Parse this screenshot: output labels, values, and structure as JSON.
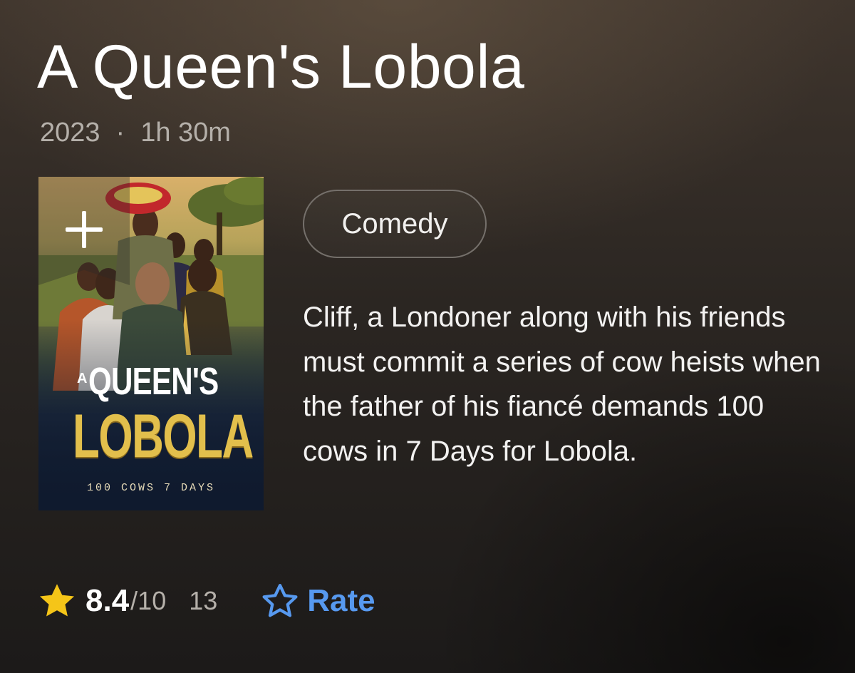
{
  "title": "A Queen's Lobola",
  "meta": {
    "year": "2023",
    "separator": "·",
    "runtime": "1h 30m"
  },
  "poster": {
    "title_small": "A",
    "title_line1": "QUEEN'S",
    "title_line2": "LOBOLA",
    "tagline": "100 COWS 7 DAYS",
    "watchlist_icon": "plus-icon"
  },
  "genres": [
    "Comedy"
  ],
  "plot": "Cliff, a Londoner along with his friends must commit a series of cow heists when the father of his fiancé demands 100 cows in 7 Days for Lobola.",
  "rating": {
    "score": "8.4",
    "max": "/10",
    "votes": "13",
    "rate_label": "Rate",
    "star_icon": "star-icon",
    "rate_icon": "star-outline-icon",
    "colors": {
      "star": "#f5c518",
      "rate": "#5799ef"
    }
  }
}
